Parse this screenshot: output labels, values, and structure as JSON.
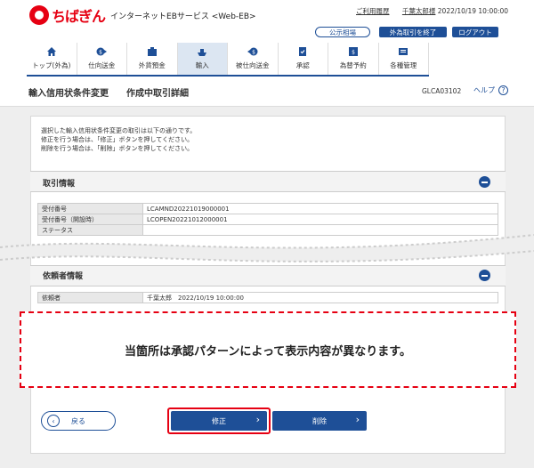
{
  "header": {
    "brand": "ちばぎん",
    "service": "インターネットEBサービス <Web-EB>",
    "usage_history": "ご利用履歴",
    "user_name": "千葉太郎様",
    "timestamp": "2022/10/19 10:00:00",
    "public_rate_btn": "公示相場",
    "fx_end_btn": "外為取引を終了",
    "logout_btn": "ログアウト"
  },
  "nav": [
    {
      "label": "トップ(外為)",
      "icon": "home-icon"
    },
    {
      "label": "仕向送金",
      "icon": "send-money-icon"
    },
    {
      "label": "外貨預金",
      "icon": "deposit-icon"
    },
    {
      "label": "輸入",
      "icon": "import-ship-icon"
    },
    {
      "label": "被仕向送金",
      "icon": "receive-money-icon"
    },
    {
      "label": "承認",
      "icon": "approve-icon"
    },
    {
      "label": "為替予約",
      "icon": "forex-icon"
    },
    {
      "label": "各種管理",
      "icon": "admin-icon"
    }
  ],
  "page": {
    "title": "輸入信用状条件変更",
    "subtitle": "作成中取引詳細",
    "screen_id": "GLCA03102",
    "help": "ヘルプ",
    "intro": [
      "選択した輸入信用状条件変更の取引は以下の通りです。",
      "修正を行う場合は、「修正」ボタンを押してください。",
      "削除を行う場合は、「削除」ボタンを押してください。"
    ]
  },
  "transaction": {
    "heading": "取引情報",
    "rows": [
      {
        "label": "受付番号",
        "value": "LCAMND20221019000001"
      },
      {
        "label": "受付番号（開設時）",
        "value": "LCOPEN20221012000001"
      },
      {
        "label": "ステータス",
        "value": ""
      }
    ]
  },
  "requester": {
    "heading": "依頼者情報",
    "rows": [
      {
        "label": "依頼者",
        "value": "千葉太郎　2022/10/19 10:00:00"
      }
    ]
  },
  "note": "当箇所は承認パターンによって表示内容が異なります。",
  "buttons": {
    "back": "戻る",
    "modify": "修正",
    "delete": "削除"
  },
  "colors": {
    "brand_red": "#e60012",
    "primary_blue": "#1e4f97"
  }
}
